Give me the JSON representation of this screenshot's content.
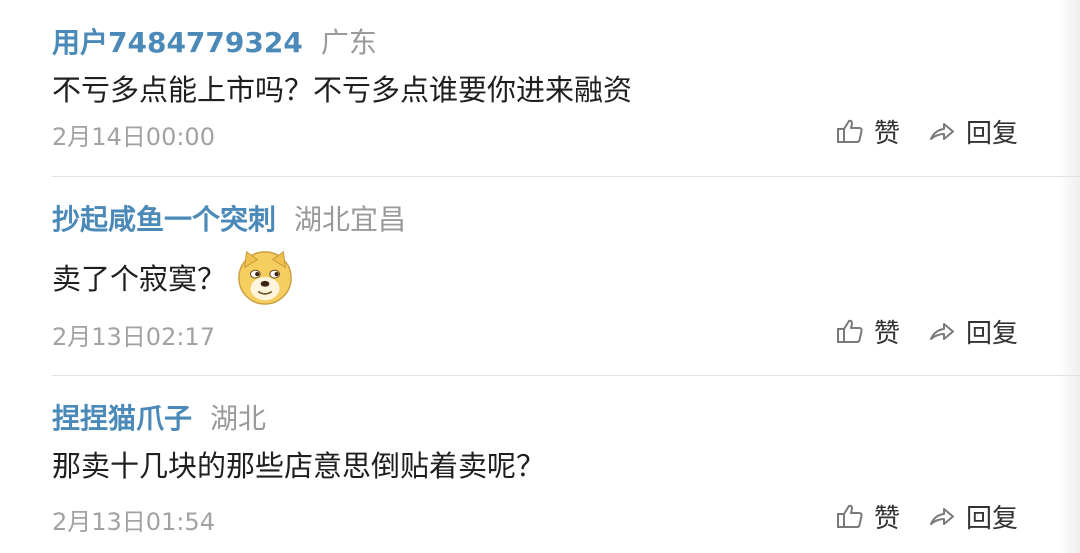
{
  "comments": [
    {
      "username": "用户7484779324",
      "location": "广东",
      "text": "不亏多点能上市吗？不亏多点谁要你进来融资",
      "time": "2月14日00:00",
      "like_label": "赞",
      "reply_label": "回复"
    },
    {
      "username": "抄起咸鱼一个突刺",
      "location": "湖北宜昌",
      "text": "卖了个寂寞？",
      "emoji": "doge-emoji",
      "time": "2月13日02:17",
      "like_label": "赞",
      "reply_label": "回复"
    },
    {
      "username": "捏捏猫爪子",
      "location": "湖北",
      "text": "那卖十几块的那些店意思倒贴着卖呢？",
      "time": "2月13日01:54",
      "like_label": "赞",
      "reply_label": "回复"
    }
  ],
  "icons": {
    "like": "thumbs-up-icon",
    "reply": "share-arrow-icon"
  },
  "colors": {
    "username": "#4b8ab8",
    "location": "#9a9a9a",
    "text": "#1f1f1f",
    "time": "#a2a2a2",
    "divider": "#e2e2e2"
  }
}
